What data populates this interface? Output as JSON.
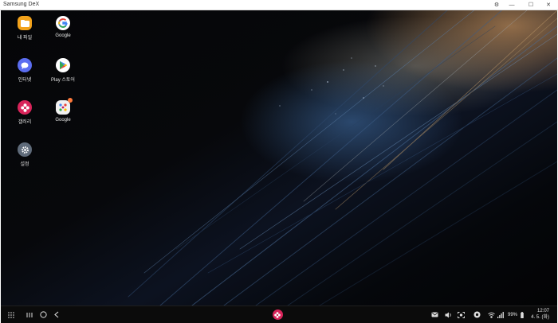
{
  "window": {
    "title": "Samsung DeX"
  },
  "apps": [
    {
      "name": "my-files",
      "label": "내 파일",
      "icon": "folder-icon",
      "color": "#f2a21b"
    },
    {
      "name": "google",
      "label": "Google",
      "icon": "google-icon",
      "color": "#ffffff"
    },
    {
      "name": "messenger",
      "label": "인터넷",
      "icon": "chat-bubble-icon",
      "color": "#5b6df0"
    },
    {
      "name": "play-store",
      "label": "Play 스토어",
      "icon": "play-store-icon",
      "color": "#ffffff"
    },
    {
      "name": "gallery",
      "label": "갤러리",
      "icon": "flower-icon",
      "color": "#d8245a"
    },
    {
      "name": "google-folder",
      "label": "Google",
      "icon": "app-folder-icon",
      "color": "#f1f1f1"
    },
    {
      "name": "settings",
      "label": "설정",
      "icon": "gear-icon",
      "color": "#5f6b7a"
    }
  ],
  "taskbar": {
    "battery": "99%",
    "time": "12:07",
    "date": "4. 5. (화)"
  }
}
